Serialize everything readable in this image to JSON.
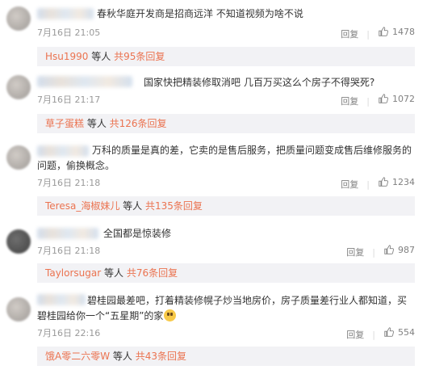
{
  "comments": [
    {
      "text": "春秋华庭开发商是招商远洋 不知道视频为啥不说",
      "time": "7月16日 21:05",
      "reply_label": "回复",
      "likes": "1478",
      "reply_summary": {
        "name": "Hsu1990",
        "middle": " 等人 ",
        "count": "共95条回复"
      }
    },
    {
      "text": "国家快把精装修取消吧 几百万买这么个房子不得哭死?",
      "time": "7月16日 21:17",
      "reply_label": "回复",
      "likes": "1072",
      "reply_summary": {
        "name": "草子蛋糕",
        "middle": " 等人 ",
        "count": "共126条回复"
      }
    },
    {
      "text_line1": "万科的质量是真的差，它卖的是售后服务，把质量问题变成售后维修服务的",
      "text_line2": "问题，偷换概念。",
      "time": "7月16日 21:18",
      "reply_label": "回复",
      "likes": "1234",
      "reply_summary": {
        "name": "Teresa_海椒妹儿",
        "middle": " 等人 ",
        "count": "共135条回复"
      }
    },
    {
      "text": "全国都是惊装修",
      "time": "7月16日 21:18",
      "reply_label": "回复",
      "likes": "987",
      "reply_summary": {
        "name": "Taylorsugar",
        "middle": " 等人 ",
        "count": "共76条回复"
      }
    },
    {
      "text_line1": "碧桂园最差吧，打着精装修幌子炒当地房价，房子质量差行业人都知道，买",
      "text_line2": "碧桂园给你一个“五星期”的家",
      "time": "7月16日 22:16",
      "reply_label": "回复",
      "likes": "554",
      "reply_summary": {
        "name": "饿A零二六零W",
        "middle": " 等人 ",
        "count": "共43条回复"
      }
    }
  ],
  "icons": {
    "like": "thumbs-up-icon",
    "emoji": "grin-emoji-icon"
  },
  "colors": {
    "name_link": "#eb7350",
    "reply_bg": "#f2f2f5",
    "meta": "#999999"
  }
}
